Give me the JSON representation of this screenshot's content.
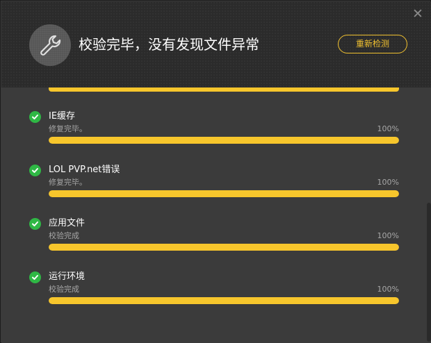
{
  "header": {
    "title": "校验完毕，没有发现文件异常",
    "recheck_label": "重新检测",
    "close_glyph": "✕",
    "icon": "wrench-icon"
  },
  "items": [
    {
      "title": "IE缓存",
      "status": "修复完毕。",
      "percent_label": "100%",
      "progress": 100
    },
    {
      "title": "LOL PVP.net错误",
      "status": "修复完毕。",
      "percent_label": "100%",
      "progress": 100
    },
    {
      "title": "应用文件",
      "status": "校验完成",
      "percent_label": "100%",
      "progress": 100
    },
    {
      "title": "运行环境",
      "status": "校验完成",
      "percent_label": "100%",
      "progress": 100
    }
  ],
  "colors": {
    "accent": "#f7c62c",
    "check": "#2fb845",
    "header_bg": "#2b2b2b",
    "body_bg": "#3b3b3b"
  }
}
